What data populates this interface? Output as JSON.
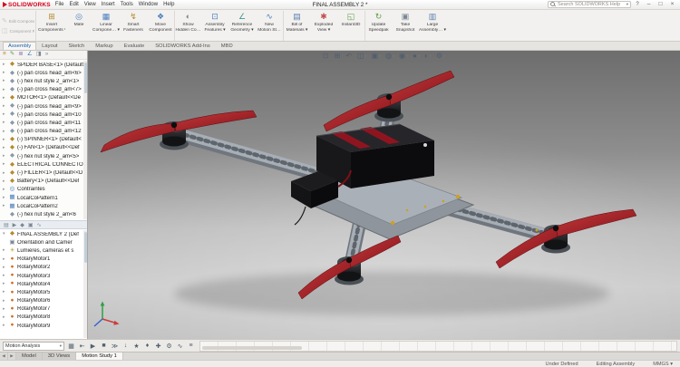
{
  "colors": {
    "solidworks_red": "#d6001c",
    "blade_red": "#9b1420",
    "frame_gray": "#a8aeb5",
    "viewport_top_gray": "#6d6d6d",
    "viewport_floor_gray": "#cbcbcb",
    "accent_blue": "#1a5f9e"
  },
  "titlebar": {
    "app_name": "SOLIDWORKS",
    "menus": [
      "File",
      "Edit",
      "View",
      "Insert",
      "Tools",
      "Window",
      "Help"
    ],
    "document_title": "FINAL ASSEMBLY 2 *",
    "search_placeholder": "Search SOLIDWORKS Help",
    "window": {
      "search_caret": "▾",
      "help": "?",
      "minimize": "–",
      "maximize": "□",
      "close": "×"
    }
  },
  "ribbon": {
    "left_stack": [
      {
        "name": "edit-component-button",
        "glyph": "✎",
        "color": "#9aa0a6",
        "label": "Edit Component",
        "disabled": true
      },
      {
        "name": "component-preview-window-button",
        "glyph": "◫",
        "color": "#9aa0a6",
        "label": "Component Preview Window",
        "disabled": true
      }
    ],
    "buttons": [
      {
        "name": "insert-components-button",
        "glyph": "⊞",
        "color": "#b58a2a",
        "l1": "Insert",
        "l2": "Components ▾"
      },
      {
        "name": "mate-button",
        "glyph": "◎",
        "color": "#4a7ebb",
        "l1": "Mate",
        "l2": ""
      },
      {
        "name": "linear-component-pattern-button",
        "glyph": "▦",
        "color": "#4a7ebb",
        "l1": "Linear",
        "l2": "Compone… ▾"
      },
      {
        "name": "smart-fasteners-button",
        "glyph": "↯",
        "color": "#b58a2a",
        "l1": "Smart",
        "l2": "Fasteners"
      },
      {
        "name": "move-component-button",
        "glyph": "❖",
        "color": "#4a7ebb",
        "l1": "Move",
        "l2": "Component"
      },
      {
        "name": "show-hidden-components-button",
        "glyph": "◐",
        "color": "#7a8794",
        "l1": "Show",
        "l2": "Hidden Co…",
        "sep": true
      },
      {
        "name": "assembly-features-button",
        "glyph": "⊡",
        "color": "#4a7ebb",
        "l1": "Assembly",
        "l2": "Features ▾"
      },
      {
        "name": "reference-geometry-button",
        "glyph": "∠",
        "color": "#3f9b8e",
        "l1": "Reference",
        "l2": "Geometry ▾"
      },
      {
        "name": "new-motion-study-button",
        "glyph": "∿",
        "color": "#4a7ebb",
        "l1": "New",
        "l2": "Motion St…"
      },
      {
        "name": "bill-of-materials-button",
        "glyph": "▤",
        "color": "#5b7fae",
        "l1": "Bill of",
        "l2": "Materials ▾",
        "sep": true
      },
      {
        "name": "exploded-view-button",
        "glyph": "✱",
        "color": "#c0504d",
        "l1": "Exploded",
        "l2": "View ▾"
      },
      {
        "name": "instant3d-button",
        "glyph": "◱",
        "color": "#5f9e4a",
        "l1": "Instant3D",
        "l2": ""
      },
      {
        "name": "update-speedpak-button",
        "glyph": "↻",
        "color": "#5f9e4a",
        "l1": "Update",
        "l2": "Speedpak",
        "sep": true
      },
      {
        "name": "take-snapshot-button",
        "glyph": "▣",
        "color": "#7a8794",
        "l1": "Take",
        "l2": "Snapshot"
      },
      {
        "name": "large-assembly-settings-button",
        "glyph": "▥",
        "color": "#5b7fae",
        "l1": "Large",
        "l2": "Assembly… ▾"
      }
    ]
  },
  "command_tabs": [
    {
      "name": "tab-assembly",
      "label": "Assembly",
      "active": true
    },
    {
      "name": "tab-layout",
      "label": "Layout"
    },
    {
      "name": "tab-sketch",
      "label": "Sketch"
    },
    {
      "name": "tab-markup",
      "label": "Markup"
    },
    {
      "name": "tab-evaluate",
      "label": "Evaluate"
    },
    {
      "name": "tab-solidworks-add-ins",
      "label": "SOLIDWORKS Add-Ins"
    },
    {
      "name": "tab-mbd",
      "label": "MBD"
    }
  ],
  "left_panel": {
    "tabs": [
      {
        "name": "featuremanager-tab-icon",
        "glyph": "≡",
        "color": "#b58a2a"
      },
      {
        "name": "propertymanager-tab-icon",
        "glyph": "✎",
        "color": "#5f9e4a"
      },
      {
        "name": "configurationmanager-tab-icon",
        "glyph": "≣",
        "color": "#8a6fae"
      },
      {
        "name": "dimxpertmanager-tab-icon",
        "glyph": "∠",
        "color": "#4a7ebb"
      },
      {
        "name": "displaymanager-tab-icon",
        "glyph": "◨",
        "color": "#7a8794"
      },
      {
        "name": "panel-expand-icon",
        "glyph": "»",
        "color": "#888888"
      }
    ],
    "feature_tree": [
      {
        "arrow": "▸",
        "glyph": "◆",
        "color": "#b58a2a",
        "label": "SPIDER BASE<1> (Default<"
      },
      {
        "arrow": "▸",
        "glyph": "◆",
        "color": "#8a98a8",
        "label": "(-) pan cross head_am<6>"
      },
      {
        "arrow": "▸",
        "glyph": "◆",
        "color": "#8a98a8",
        "label": "(-) hex nut style 2_am<1>"
      },
      {
        "arrow": "▸",
        "glyph": "◆",
        "color": "#8a98a8",
        "label": "(-) pan cross head_am<7>"
      },
      {
        "arrow": "▸",
        "glyph": "◆",
        "color": "#b58a2a",
        "label": "MOTOR<1> (Default<<De"
      },
      {
        "arrow": "▸",
        "glyph": "◆",
        "color": "#8a98a8",
        "label": "(-) pan cross head_am<9>"
      },
      {
        "arrow": "▸",
        "glyph": "◆",
        "color": "#8a98a8",
        "label": "(-) pan cross head_am<10"
      },
      {
        "arrow": "▸",
        "glyph": "◆",
        "color": "#8a98a8",
        "label": "(-) pan cross head_am<11"
      },
      {
        "arrow": "▸",
        "glyph": "◆",
        "color": "#8a98a8",
        "label": "(-) pan cross head_am<12"
      },
      {
        "arrow": "▸",
        "glyph": "◆",
        "color": "#b58a2a",
        "label": "(-) SPINNER<1> (Default<"
      },
      {
        "arrow": "▸",
        "glyph": "◆",
        "color": "#b58a2a",
        "label": "(-) FAN<1> (Default<<Def"
      },
      {
        "arrow": "▸",
        "glyph": "◆",
        "color": "#8a98a8",
        "label": "(-) hex nut style 2_am<5>"
      },
      {
        "arrow": "▸",
        "glyph": "◆",
        "color": "#b58a2a",
        "label": "ELECTRICAL CONNECTO"
      },
      {
        "arrow": "▸",
        "glyph": "◆",
        "color": "#b58a2a",
        "label": "(-) FILLER<1> (Default<<D"
      },
      {
        "arrow": "▸",
        "glyph": "◆",
        "color": "#b58a2a",
        "label": "Battery<1> (Default<<Def"
      },
      {
        "arrow": "▸",
        "glyph": "◎",
        "color": "#4a7ebb",
        "label": "Contraintes"
      },
      {
        "arrow": "▸",
        "glyph": "▦",
        "color": "#4a7ebb",
        "label": "LocalCoPattern1"
      },
      {
        "arrow": "▸",
        "glyph": "▦",
        "color": "#4a7ebb",
        "label": "LocalCoPattern2"
      },
      {
        "arrow": "",
        "glyph": "◆",
        "color": "#8a98a8",
        "label": "(-) hex nut style 2_am<6"
      }
    ],
    "motion_toolbar_icons": [
      {
        "name": "motion-filter-all-icon",
        "glyph": "▤",
        "color": "#7a8794"
      },
      {
        "name": "motion-filter-animated-icon",
        "glyph": "▶",
        "color": "#7a8794"
      },
      {
        "name": "motion-filter-driving-icon",
        "glyph": "◆",
        "color": "#7a8794"
      },
      {
        "name": "motion-filter-selected-icon",
        "glyph": "▣",
        "color": "#7a8794"
      },
      {
        "name": "motion-filter-results-icon",
        "glyph": "∿",
        "color": "#7a8794"
      }
    ],
    "motion_tree": [
      {
        "arrow": "▾",
        "glyph": "◆",
        "color": "#b58a2a",
        "label": "FINAL ASSEMBLY 2 (Def"
      },
      {
        "arrow": "",
        "glyph": "▣",
        "color": "#7a8794",
        "label": "Orientation and Camer"
      },
      {
        "arrow": "▸",
        "glyph": "☀",
        "color": "#c9a227",
        "label": "Lumières, caméras et s"
      },
      {
        "arrow": "▸",
        "glyph": "●",
        "color": "#d2691e",
        "label": "RotaryMotor1"
      },
      {
        "arrow": "▸",
        "glyph": "●",
        "color": "#d2691e",
        "label": "RotaryMotor2"
      },
      {
        "arrow": "▸",
        "glyph": "●",
        "color": "#d2691e",
        "label": "RotaryMotor3"
      },
      {
        "arrow": "▸",
        "glyph": "●",
        "color": "#d2691e",
        "label": "RotaryMotor4"
      },
      {
        "arrow": "▸",
        "glyph": "●",
        "color": "#d2691e",
        "label": "RotaryMotor5"
      },
      {
        "arrow": "▸",
        "glyph": "●",
        "color": "#d2691e",
        "label": "RotaryMotor6"
      },
      {
        "arrow": "▸",
        "glyph": "●",
        "color": "#d2691e",
        "label": "RotaryMotor7"
      },
      {
        "arrow": "▸",
        "glyph": "●",
        "color": "#d2691e",
        "label": "RotaryMotor8"
      },
      {
        "arrow": "▸",
        "glyph": "●",
        "color": "#d2691e",
        "label": "RotaryMotor9"
      }
    ]
  },
  "viewport": {
    "hud_icons": [
      {
        "name": "zoom-fit-icon",
        "glyph": "⊡",
        "caret": ""
      },
      {
        "name": "zoom-area-icon",
        "glyph": "⊞",
        "caret": ""
      },
      {
        "name": "previous-view-icon",
        "glyph": "↶",
        "caret": ""
      },
      {
        "name": "section-view-icon",
        "glyph": "◫",
        "caret": "▾"
      },
      {
        "name": "view-orientation-icon",
        "glyph": "▣",
        "caret": "▾"
      },
      {
        "name": "display-style-icon",
        "glyph": "◍",
        "caret": "▾"
      },
      {
        "name": "hide-show-items-icon",
        "glyph": "◉",
        "caret": "▾"
      },
      {
        "name": "edit-appearance-icon",
        "glyph": "●",
        "caret": "▾"
      },
      {
        "name": "apply-scene-icon",
        "glyph": "◐",
        "caret": "▾"
      },
      {
        "name": "view-settings-icon",
        "glyph": "⚙",
        "caret": "▾"
      }
    ]
  },
  "motion_study": {
    "type_selector": "Motion Analysis",
    "caret": "▾",
    "icons": [
      {
        "name": "calculate-icon",
        "glyph": "▦"
      },
      {
        "name": "play-from-start-icon",
        "glyph": "⇤"
      },
      {
        "name": "play-icon",
        "glyph": "▶"
      },
      {
        "name": "stop-icon",
        "glyph": "■"
      },
      {
        "name": "playback-speed-icon",
        "glyph": "≫"
      },
      {
        "name": "save-animation-icon",
        "glyph": "↓"
      },
      {
        "name": "animation-wizard-icon",
        "glyph": "★"
      },
      {
        "name": "auto-key-icon",
        "glyph": "♦"
      },
      {
        "name": "add-key-icon",
        "glyph": "✚"
      },
      {
        "name": "simulation-elements-icon",
        "glyph": "⚙"
      },
      {
        "name": "results-plots-icon",
        "glyph": "∿"
      },
      {
        "name": "motion-study-properties-icon",
        "glyph": "≡"
      }
    ]
  },
  "bottom_tabs": {
    "nav_left": "◀",
    "nav_right": "▶",
    "tabs": [
      {
        "name": "tab-model",
        "label": "Model"
      },
      {
        "name": "tab-3d-views",
        "label": "3D Views"
      },
      {
        "name": "tab-motion-study-1",
        "label": "Motion Study 1",
        "active": true
      }
    ]
  },
  "statusbar": {
    "items": [
      "Under Defined",
      "Editing Assembly",
      "MMGS ▾"
    ]
  }
}
